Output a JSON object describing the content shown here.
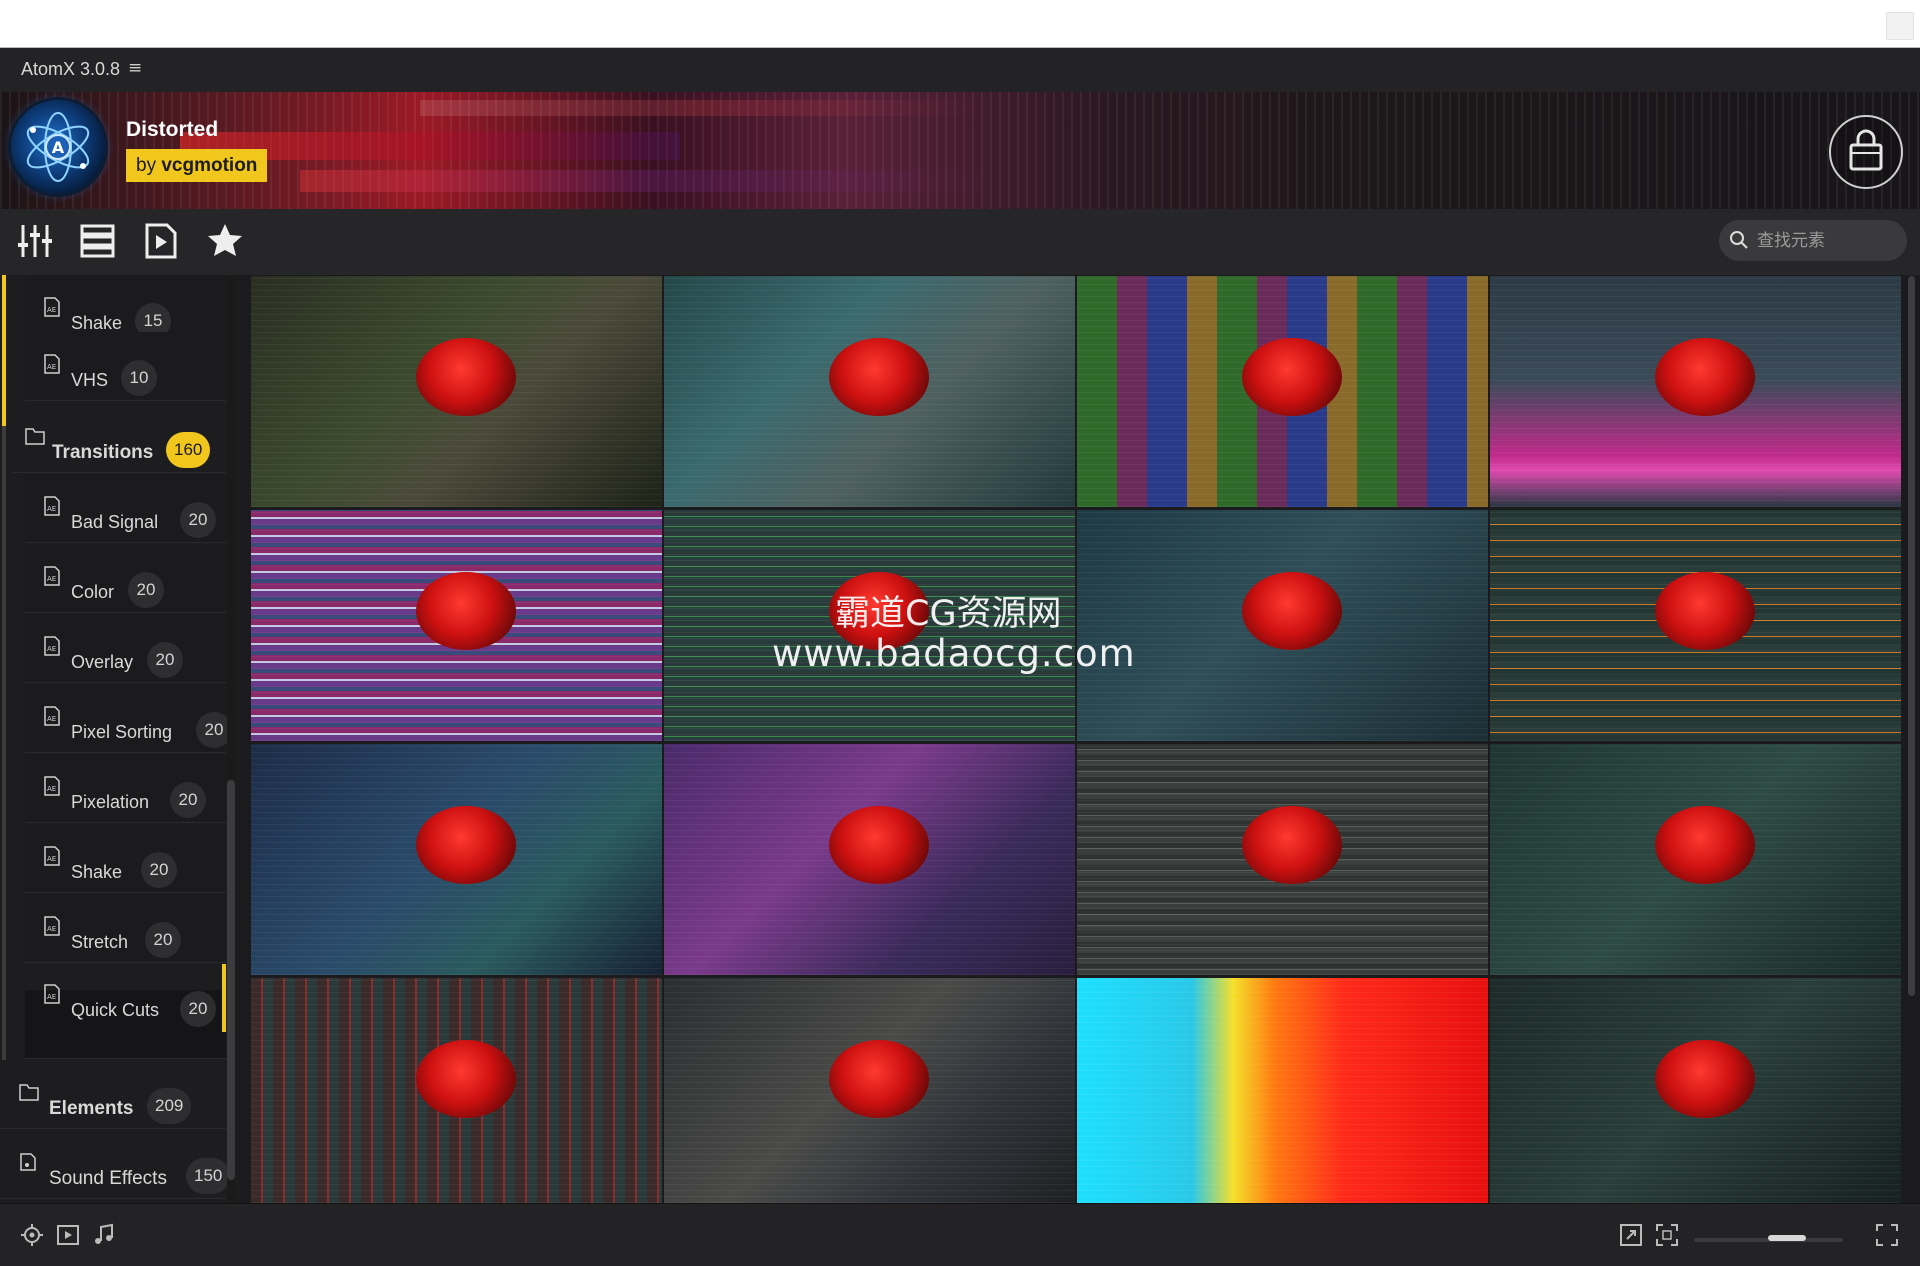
{
  "app": {
    "title": "AtomX 3.0.8",
    "menu_glyph": "≡"
  },
  "pack": {
    "name": "Distorted",
    "author_prefix": "by",
    "author": "vcgmotion"
  },
  "toolbar": {
    "icons": [
      "sliders-icon",
      "list-view-icon",
      "preview-play-icon",
      "favorites-star-icon"
    ]
  },
  "search": {
    "placeholder": "查找元素"
  },
  "sidebar": {
    "items": [
      {
        "label": "Shake",
        "count": "15",
        "type": "child"
      },
      {
        "label": "VHS",
        "count": "10",
        "type": "child"
      },
      {
        "label": "Transitions",
        "count": "160",
        "type": "parent",
        "highlighted": true
      },
      {
        "label": "Bad Signal",
        "count": "20",
        "type": "child"
      },
      {
        "label": "Color",
        "count": "20",
        "type": "child"
      },
      {
        "label": "Overlay",
        "count": "20",
        "type": "child"
      },
      {
        "label": "Pixel Sorting",
        "count": "20",
        "type": "child"
      },
      {
        "label": "Pixelation",
        "count": "20",
        "type": "child"
      },
      {
        "label": "Shake",
        "count": "20",
        "type": "child"
      },
      {
        "label": "Stretch",
        "count": "20",
        "type": "child"
      },
      {
        "label": "Quick Cuts",
        "count": "20",
        "type": "child",
        "active": true
      },
      {
        "label": "Elements",
        "count": "209",
        "type": "parent"
      },
      {
        "label": "Sound Effects",
        "count": "150",
        "type": "parent"
      }
    ]
  },
  "grid": {
    "tiles": [
      {
        "style": "dim-green"
      },
      {
        "style": "teal-glitch"
      },
      {
        "style": "rgb-blocks"
      },
      {
        "style": "magenta-streak"
      },
      {
        "style": "horizontal-stretch"
      },
      {
        "style": "scanline-green"
      },
      {
        "style": "dark-teal"
      },
      {
        "style": "orange-lines"
      },
      {
        "style": "blue-teal"
      },
      {
        "style": "purple-pixel"
      },
      {
        "style": "gray-lines"
      },
      {
        "style": "dark-teal-2"
      },
      {
        "style": "red-grid"
      },
      {
        "style": "dim-blur"
      },
      {
        "style": "posterized-color"
      },
      {
        "style": "dark-green"
      }
    ]
  },
  "watermark": {
    "line1": "霸道CG资源网",
    "line2": "www.badaocg.com"
  },
  "bottom": {
    "left_icons": [
      "settings-icon",
      "video-icon",
      "music-icon"
    ],
    "right_icons": [
      "expand-icon",
      "fullscreen-icon",
      "fit-icon"
    ],
    "zoom_level": 0.5
  },
  "colors": {
    "accent": "#f2c71d",
    "background": "#1b1b1d",
    "panel": "#262628"
  }
}
